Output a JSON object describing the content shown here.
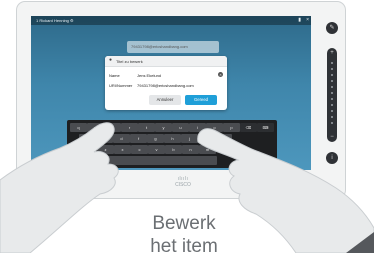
{
  "statusbar": {
    "title": "1 Rickard Henning   ⚙",
    "gear_icon": "gear-icon",
    "signal_icon": "signal-icon",
    "close_icon": "close-icon"
  },
  "contact_preview": "79431798@ericshandbang.com",
  "dialog": {
    "title": "Titel zu bewerk",
    "name_label": "Name",
    "name_value": "Jens Ekelund",
    "uri_label": "URI/Nummer",
    "uri_value": "79431798@ericshandbang.com",
    "cancel_label": "Annuleer",
    "save_label": "Gereed"
  },
  "keyboard": {
    "row1": [
      "q",
      "w",
      "e",
      "r",
      "t",
      "y",
      "u",
      "i",
      "o",
      "p",
      "⌫",
      "⌨"
    ],
    "row2": [
      "a",
      "s",
      "d",
      "f",
      "g",
      "h",
      "j",
      "k",
      "l"
    ],
    "row3": [
      "z",
      "x",
      "c",
      "v",
      "b",
      "n",
      "m"
    ]
  },
  "rail": {
    "plus": "+",
    "minus": "−"
  },
  "brand": {
    "logo_bars": "ılıılı",
    "logo_text": "CISCO"
  },
  "caption": {
    "line1": "Bewerk",
    "line2": "het item"
  },
  "colors": {
    "screen": "#3f86ab",
    "save_button": "#1f9fd8",
    "keyboard": "#1e1f21"
  }
}
